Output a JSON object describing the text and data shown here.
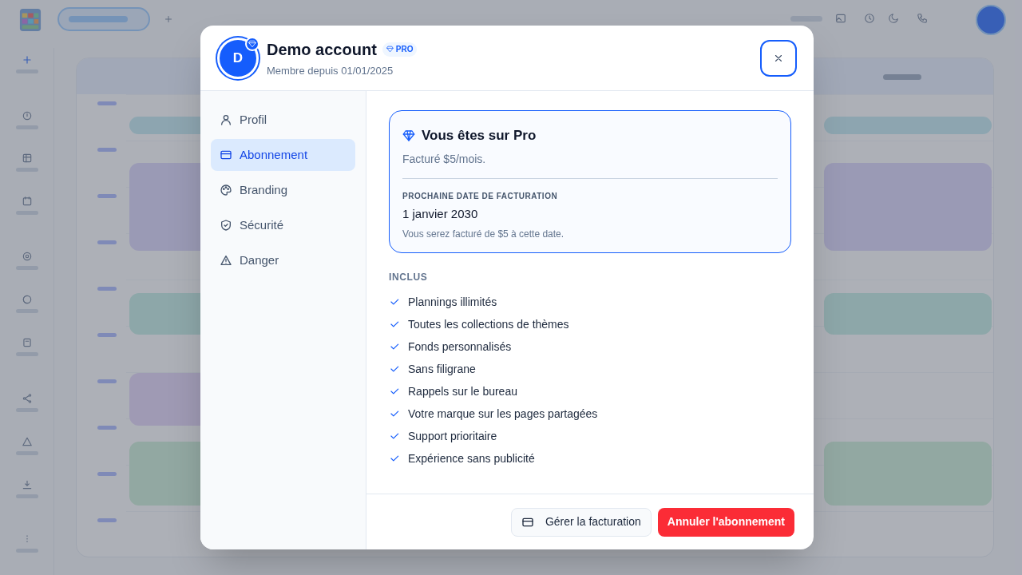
{
  "modal": {
    "avatar_initial": "D",
    "name": "Demo account",
    "badge": "PRO",
    "member_since": "Membre depuis 01/01/2025",
    "nav": [
      {
        "label": "Profil",
        "selected": false
      },
      {
        "label": "Abonnement",
        "selected": true
      },
      {
        "label": "Branding",
        "selected": false
      },
      {
        "label": "Sécurité",
        "selected": false
      },
      {
        "label": "Danger",
        "selected": false
      }
    ],
    "plan": {
      "title": "Vous êtes sur Pro",
      "price": "Facturé $5/mois.",
      "next_label": "PROCHAINE DATE DE FACTURATION",
      "next_date": "1 janvier 2030",
      "note": "Vous serez facturé de $5 à cette date."
    },
    "included_heading": "INCLUS",
    "features": [
      "Plannings illimités",
      "Toutes les collections de thèmes",
      "Fonds personnalisés",
      "Sans filigrane",
      "Rappels sur le bureau",
      "Votre marque sur les pages partagées",
      "Support prioritaire",
      "Expérience sans publicité"
    ],
    "manage_button": "Gérer la facturation",
    "cancel_button": "Annuler l'abonnement"
  }
}
